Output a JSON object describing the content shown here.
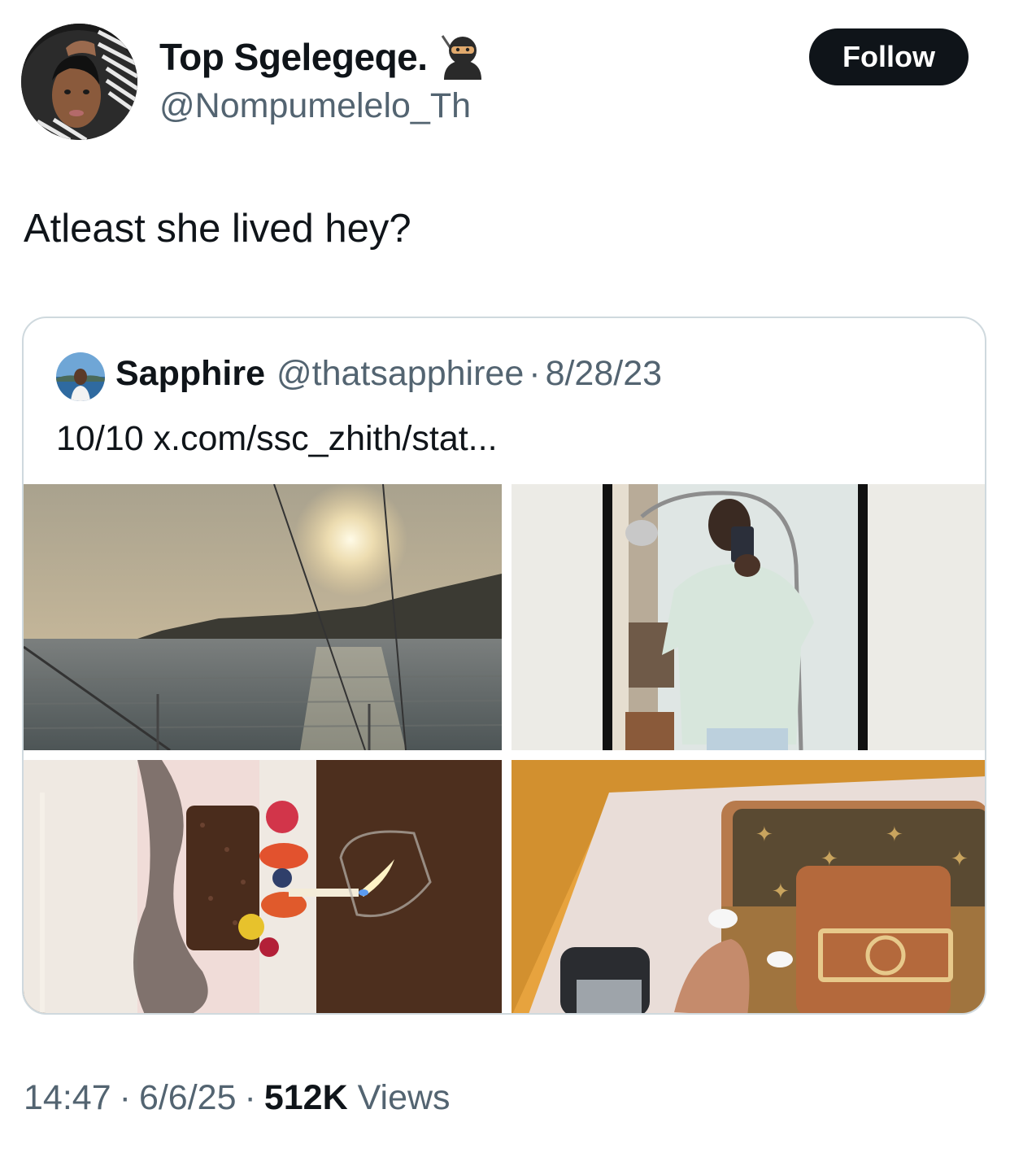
{
  "author": {
    "display_name": "Top Sgelegeqe.",
    "handle": "@Nompumelelo_Th",
    "badge_icon": "ninja-emoji-icon"
  },
  "follow_button": {
    "label": "Follow"
  },
  "tweet": {
    "text": "Atleast she lived hey?"
  },
  "quote": {
    "display_name": "Sapphire",
    "handle": "@thatsapphiree",
    "separator": "·",
    "date": "8/28/23",
    "text": "10/10 x.com/ssc_zhith/stat...",
    "media": [
      {
        "name": "sunset-sea-photo"
      },
      {
        "name": "mirror-selfie-photo"
      },
      {
        "name": "birthday-cake-photo"
      },
      {
        "name": "designer-bag-photo"
      }
    ]
  },
  "meta": {
    "time": "14:47",
    "date": "6/6/25",
    "separator": "·",
    "views_count": "512K",
    "views_label": "Views"
  },
  "colors": {
    "primary_text": "#0f1419",
    "secondary_text": "#536471",
    "border": "#cfd9de",
    "button_bg": "#0f1419"
  }
}
